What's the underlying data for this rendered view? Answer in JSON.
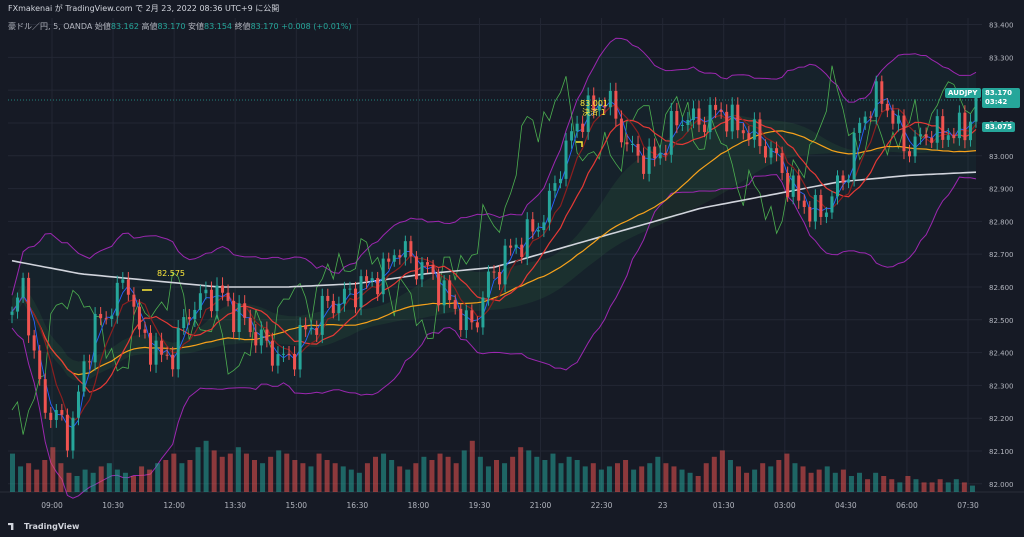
{
  "header": {
    "line1": "FXmakenai が TradingView.com で 2月 23, 2022 08:36 UTC+9 に公開",
    "symbol": "豪ドル／円, 5, OANDA",
    "open_label": "始値",
    "open_value": "83.162",
    "high_label": "高値",
    "high_value": "83.170",
    "low_label": "安値",
    "low_value": "83.154",
    "close_label": "終値",
    "close_value": "83.170",
    "change": "+0.008 (+0.01%)"
  },
  "price_tags": {
    "symbol_tag": "AUDJPY",
    "price": "83.170",
    "countdown": "03:42",
    "ma_value": "83.075"
  },
  "annotations": {
    "label_1": "82.575",
    "label_2": "83.001",
    "label_3": "決済 1"
  },
  "footer": {
    "brand": "TradingView"
  },
  "colors": {
    "background": "#161a25",
    "up": "#26a69a",
    "down": "#ef5350",
    "bollinger": "#9c27b0",
    "ma_slow": "#d1d4dc",
    "ma_orange": "#f7a21b",
    "ma_red": "#e53935",
    "signal_green": "#4caf50",
    "annotation": "#ffeb3b"
  },
  "chart_data": {
    "type": "candlestick",
    "instrument": "AUDJPY",
    "interval": "5",
    "y_ticks": [
      "83.400",
      "83.300",
      "83.200",
      "83.100",
      "83.000",
      "82.900",
      "82.800",
      "82.700",
      "82.600",
      "82.500",
      "82.400",
      "82.300",
      "82.200",
      "82.100",
      "82.000"
    ],
    "ylim": [
      81.975,
      83.42
    ],
    "x_ticks": [
      "09:00",
      "10:30",
      "12:00",
      "13:30",
      "15:00",
      "16:30",
      "18:00",
      "19:30",
      "21:00",
      "22:30",
      "23",
      "01:30",
      "03:00",
      "04:30",
      "06:00",
      "07:30"
    ],
    "close_path": [
      [
        82.5,
        82.62
      ],
      [
        82.35,
        82.22
      ],
      [
        82.2,
        82.14
      ],
      [
        82.32,
        82.48
      ],
      [
        82.5,
        82.58
      ],
      [
        82.62,
        82.45
      ],
      [
        82.42,
        82.38
      ],
      [
        82.4,
        82.52
      ],
      [
        82.55,
        82.58
      ],
      [
        82.58,
        82.52
      ],
      [
        82.5,
        82.45
      ],
      [
        82.42,
        82.38
      ],
      [
        82.38,
        82.46
      ],
      [
        82.48,
        82.55
      ],
      [
        82.55,
        82.58
      ],
      [
        82.6,
        82.62
      ],
      [
        82.64,
        82.72
      ],
      [
        82.7,
        82.66
      ],
      [
        82.65,
        82.58
      ],
      [
        82.55,
        82.48
      ],
      [
        82.5,
        82.62
      ],
      [
        82.66,
        82.72
      ],
      [
        82.74,
        82.78
      ],
      [
        82.82,
        82.95
      ],
      [
        83.05,
        83.12
      ],
      [
        83.14,
        83.18
      ],
      [
        83.12,
        83.02
      ],
      [
        83.0,
        82.98
      ],
      [
        83.02,
        83.1
      ],
      [
        83.12,
        83.1
      ],
      [
        83.12,
        83.14
      ],
      [
        83.1,
        83.08
      ],
      [
        83.06,
        83.02
      ],
      [
        82.98,
        82.9
      ],
      [
        82.86,
        82.82
      ],
      [
        82.84,
        82.9
      ],
      [
        82.96,
        83.1
      ],
      [
        83.16,
        83.18
      ],
      [
        83.1,
        83.02
      ],
      [
        83.04,
        83.08
      ],
      [
        83.06,
        83.08
      ],
      [
        83.07,
        83.17
      ]
    ],
    "slow_ma": [
      82.68,
      82.64,
      82.62,
      82.6,
      82.6,
      82.61,
      82.64,
      82.66,
      82.72,
      82.78,
      82.84,
      82.88,
      82.92,
      82.94,
      82.95
    ],
    "volume": [
      12,
      8,
      9,
      7,
      10,
      14,
      9,
      6,
      5,
      7,
      6,
      8,
      9,
      7,
      6,
      5,
      8,
      7,
      9,
      10,
      12,
      9,
      10,
      14,
      16,
      13,
      11,
      12,
      14,
      12,
      10,
      9,
      11,
      13,
      12,
      10,
      9,
      8,
      12,
      10,
      9,
      8,
      7,
      6,
      9,
      11,
      12,
      10,
      8,
      7,
      9,
      11,
      10,
      12,
      11,
      9,
      13,
      16,
      11,
      8,
      10,
      9,
      11,
      14,
      13,
      11,
      10,
      12,
      9,
      11,
      10,
      8,
      9,
      7,
      8,
      9,
      10,
      7,
      8,
      9,
      11,
      9,
      8,
      7,
      6,
      5,
      9,
      11,
      13,
      10,
      8,
      6,
      7,
      9,
      8,
      10,
      12,
      9,
      8,
      6,
      7,
      8,
      6,
      7,
      5,
      6,
      4,
      6,
      5,
      4,
      3,
      5,
      4,
      3,
      3,
      4,
      3,
      4,
      3,
      2
    ]
  }
}
